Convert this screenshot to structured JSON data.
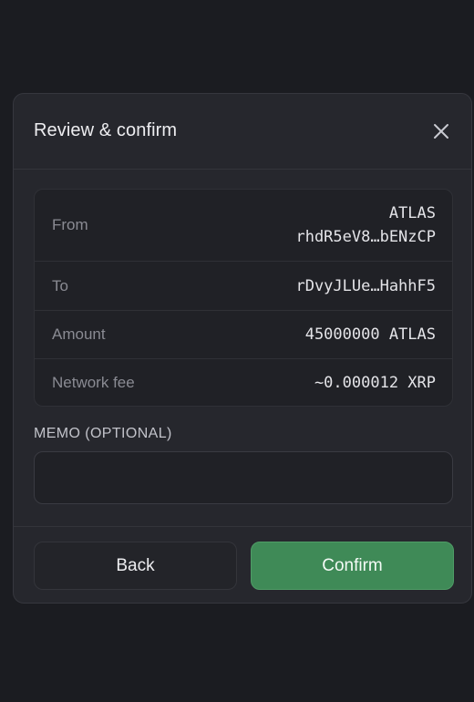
{
  "dialog": {
    "title": "Review & confirm",
    "close_icon": "close-icon"
  },
  "summary": {
    "from": {
      "label": "From",
      "token": "ATLAS",
      "address": "rhdR5eV8…bENzCP"
    },
    "to": {
      "label": "To",
      "address": "rDvyJLUe…HahhF5"
    },
    "amount": {
      "label": "Amount",
      "value": "45000000 ATLAS"
    },
    "fee": {
      "label": "Network fee",
      "value": "~0.000012 XRP"
    }
  },
  "memo": {
    "label": "MEMO (OPTIONAL)",
    "value": "",
    "placeholder": ""
  },
  "footer": {
    "back_label": "Back",
    "confirm_label": "Confirm"
  },
  "colors": {
    "background": "#1b1c21",
    "panel": "#26272d",
    "confirm": "#3f8a57"
  }
}
